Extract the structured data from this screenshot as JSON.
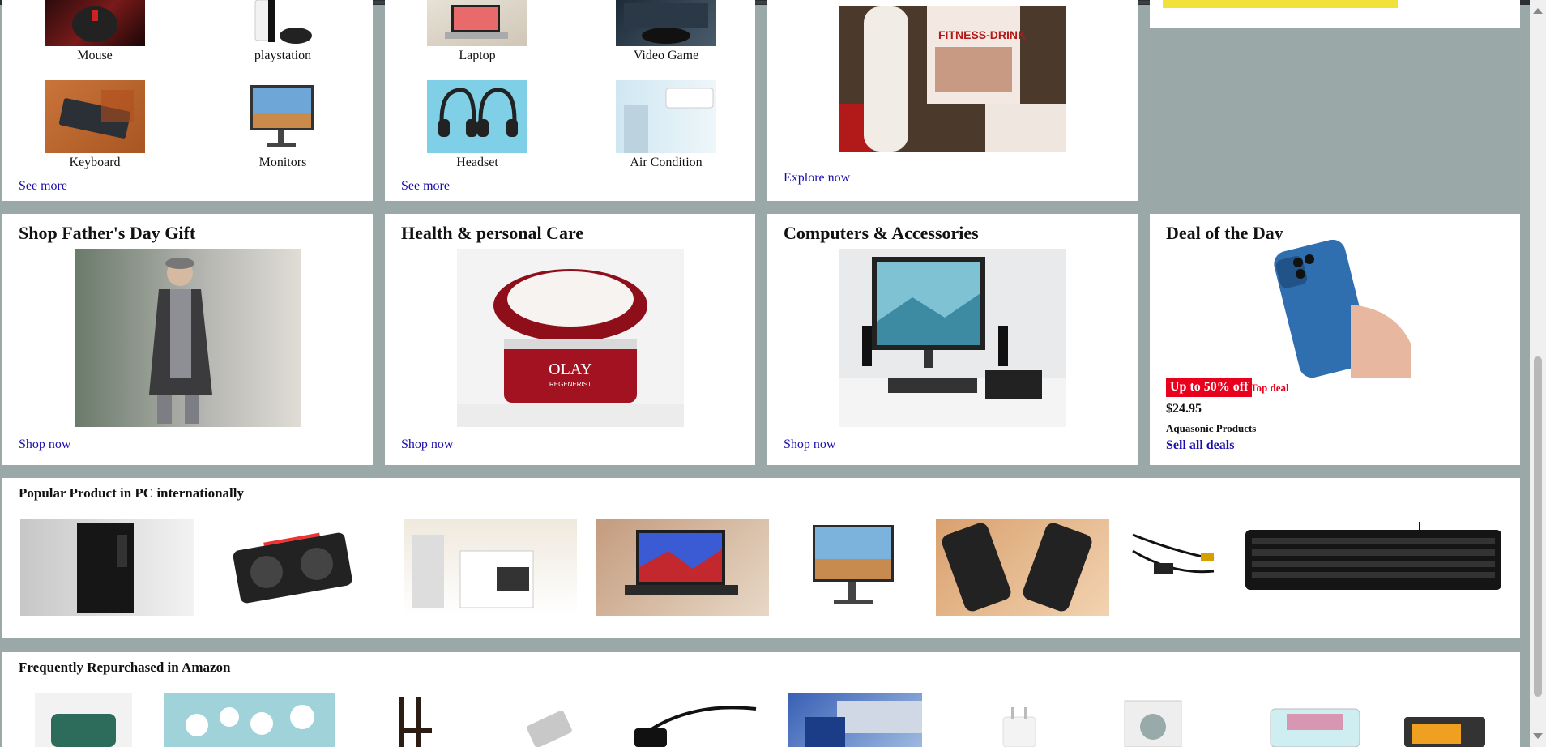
{
  "row1": {
    "card1": {
      "items": [
        {
          "label": "Mouse"
        },
        {
          "label": "playstation"
        },
        {
          "label": "Keyboard"
        },
        {
          "label": "Monitors"
        }
      ],
      "link": "See more"
    },
    "card2": {
      "items": [
        {
          "label": "Laptop"
        },
        {
          "label": "Video Game"
        },
        {
          "label": "Headset"
        },
        {
          "label": "Air Condition"
        }
      ],
      "link": "See more"
    },
    "card3": {
      "link": "Explore now",
      "product_text": "FITNESS-DRINK"
    }
  },
  "row2": {
    "fathers_day": {
      "title": "Shop Father's Day Gift",
      "link": "Shop now"
    },
    "health": {
      "title": "Health & personal Care",
      "link": "Shop now",
      "jar_brand": "OLAY",
      "jar_line": "REGENERIST"
    },
    "computers": {
      "title": "Computers & Accessories",
      "link": "Shop now"
    },
    "deal": {
      "title": "Deal of the Day",
      "badge": "Up to 50% off",
      "badge_sub": "Top deal",
      "price": "$24.95",
      "brand": "Aquasonic Products",
      "link": "Sell all deals"
    }
  },
  "popular": {
    "title": "Popular Product in PC internationally"
  },
  "repurchased": {
    "title": "Frequently Repurchased in Amazon"
  },
  "colors": {
    "deal_red": "#e8001c",
    "link_blue": "#1a0dab",
    "page_bg": "#9aa8a8"
  }
}
